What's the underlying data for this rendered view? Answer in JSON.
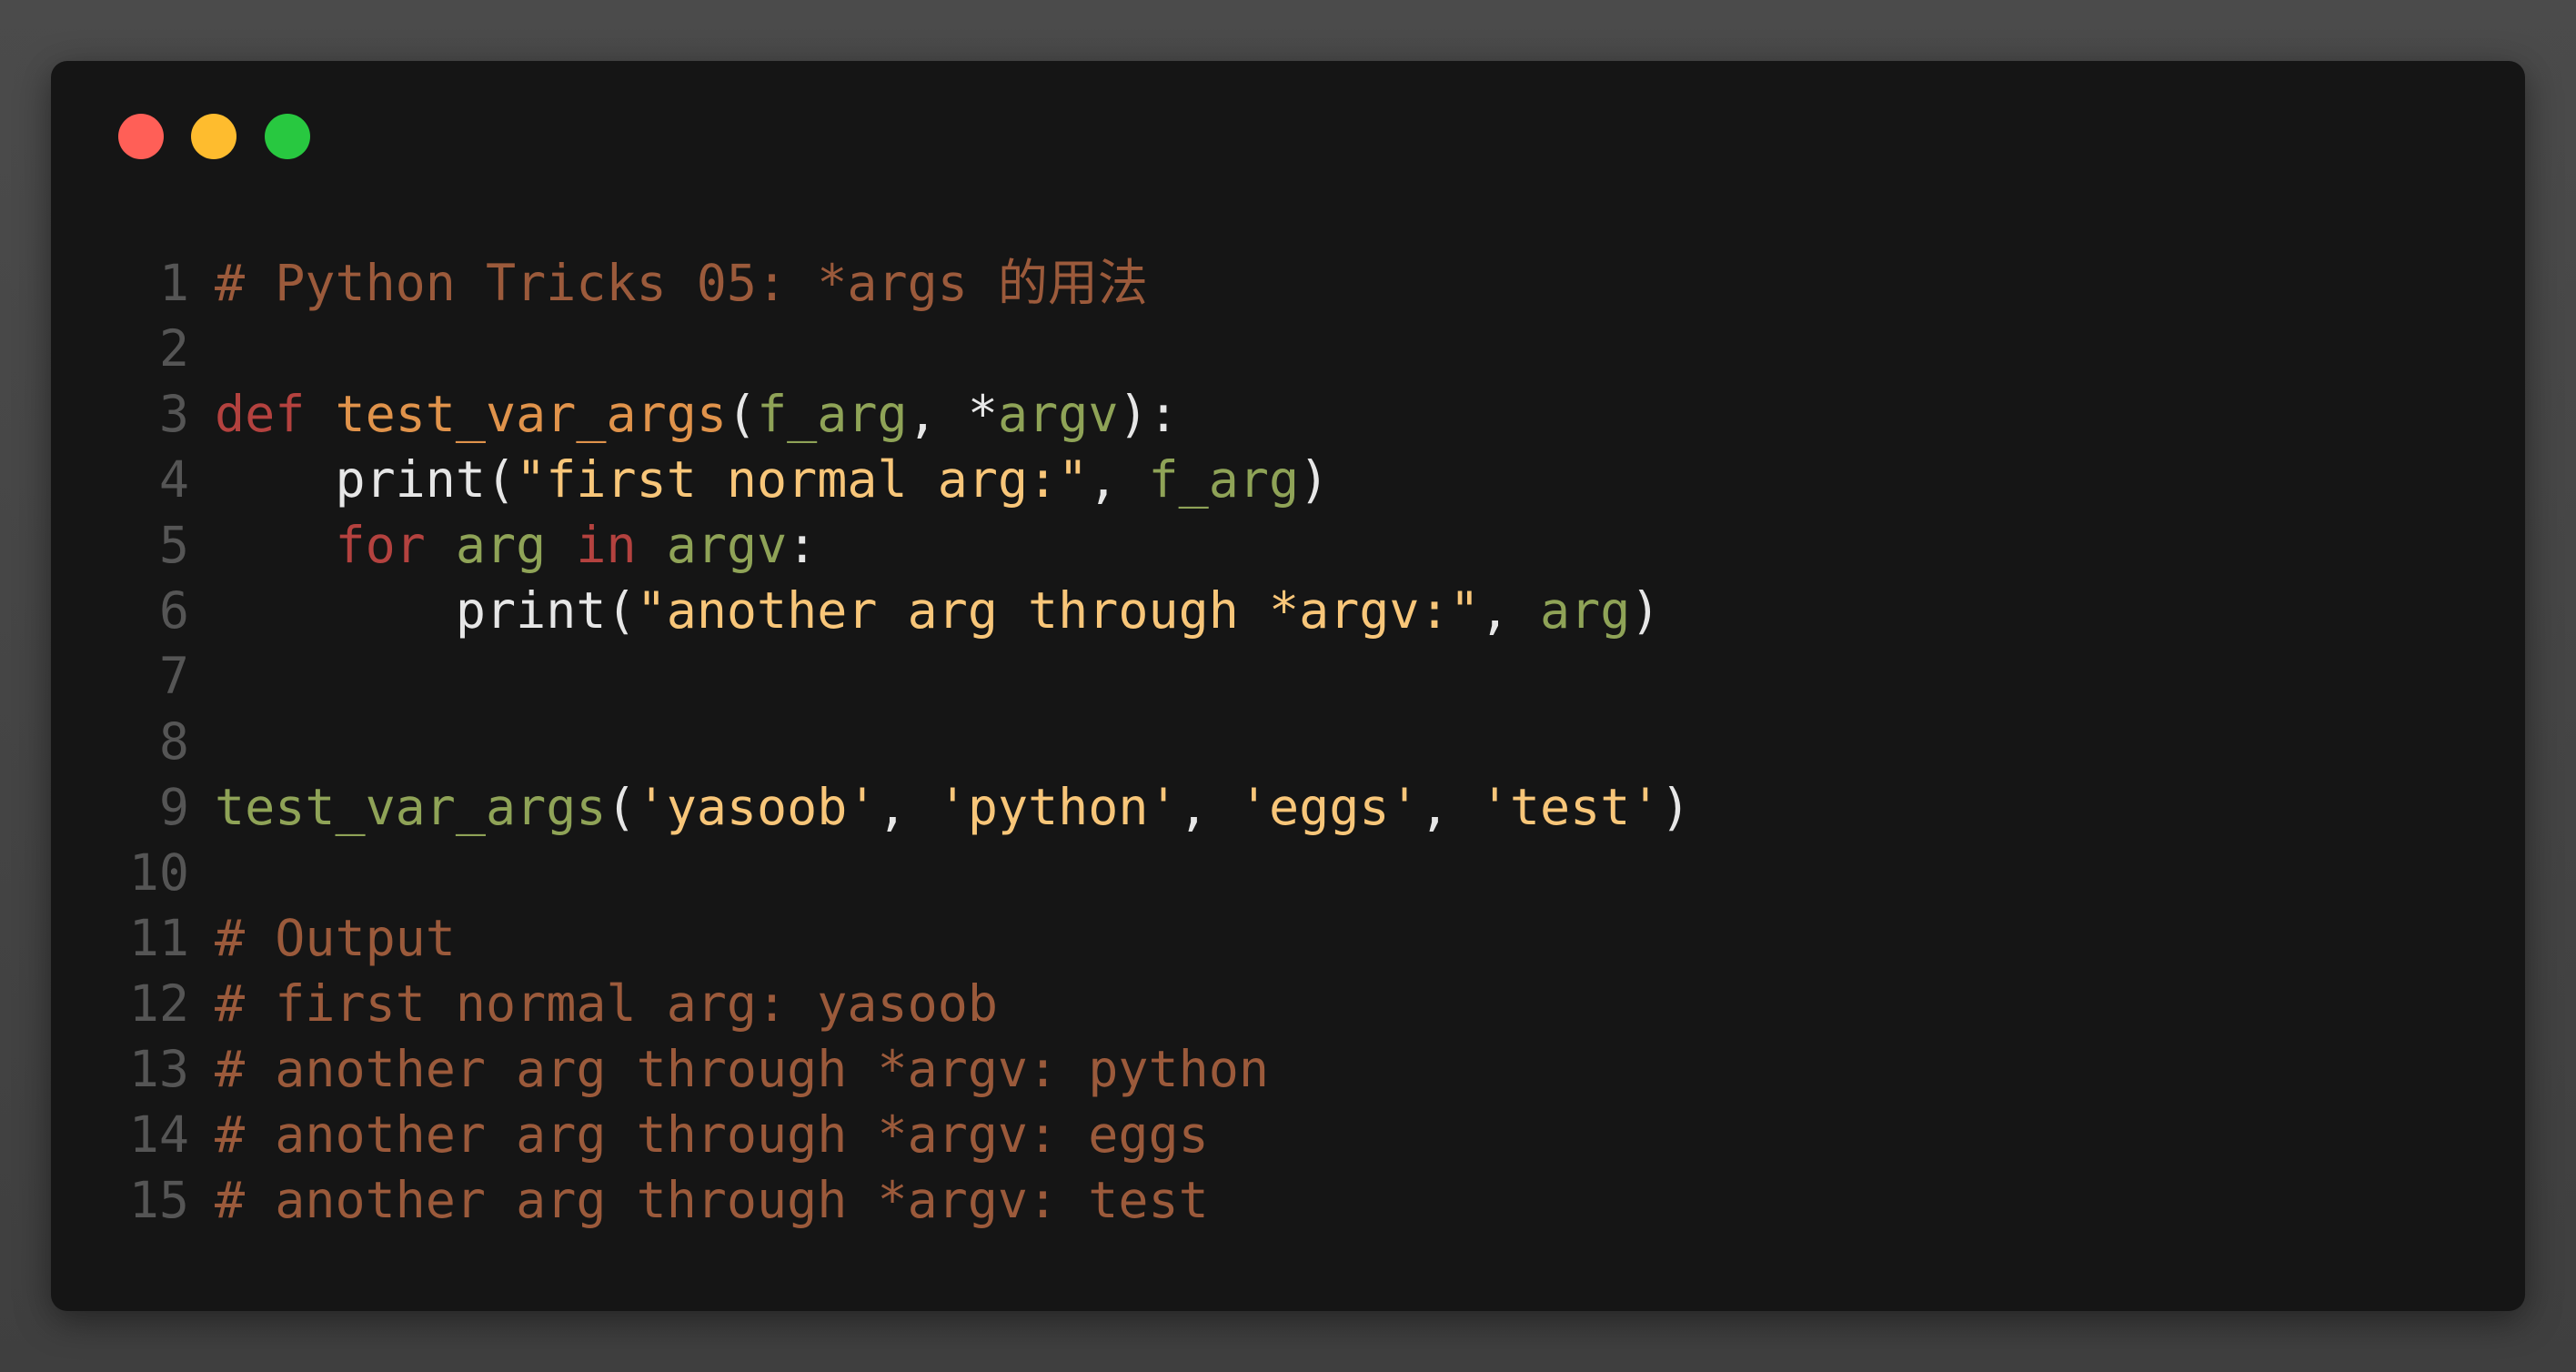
{
  "window": {
    "controls": [
      {
        "name": "close",
        "color": "#ff5f57"
      },
      {
        "name": "minimize",
        "color": "#febc2e"
      },
      {
        "name": "maximize",
        "color": "#28c840"
      }
    ]
  },
  "code": {
    "language": "python",
    "lines": [
      {
        "n": "1",
        "tokens": [
          {
            "t": "# Python Tricks 05: *args 的用法",
            "k": "comment"
          }
        ]
      },
      {
        "n": "2",
        "tokens": []
      },
      {
        "n": "3",
        "tokens": [
          {
            "t": "def",
            "k": "keyword"
          },
          {
            "t": " ",
            "k": "plain"
          },
          {
            "t": "test_var_args",
            "k": "func"
          },
          {
            "t": "(",
            "k": "plain"
          },
          {
            "t": "f_arg",
            "k": "param"
          },
          {
            "t": ", *",
            "k": "plain"
          },
          {
            "t": "argv",
            "k": "param"
          },
          {
            "t": "):",
            "k": "plain"
          }
        ]
      },
      {
        "n": "4",
        "tokens": [
          {
            "t": "    print(",
            "k": "plain"
          },
          {
            "t": "\"first normal arg:\"",
            "k": "string"
          },
          {
            "t": ", ",
            "k": "plain"
          },
          {
            "t": "f_arg",
            "k": "param"
          },
          {
            "t": ")",
            "k": "plain"
          }
        ]
      },
      {
        "n": "5",
        "tokens": [
          {
            "t": "    ",
            "k": "plain"
          },
          {
            "t": "for",
            "k": "keyword"
          },
          {
            "t": " ",
            "k": "plain"
          },
          {
            "t": "arg",
            "k": "param"
          },
          {
            "t": " ",
            "k": "plain"
          },
          {
            "t": "in",
            "k": "keyword"
          },
          {
            "t": " ",
            "k": "plain"
          },
          {
            "t": "argv",
            "k": "param"
          },
          {
            "t": ":",
            "k": "plain"
          }
        ]
      },
      {
        "n": "6",
        "tokens": [
          {
            "t": "        print(",
            "k": "plain"
          },
          {
            "t": "\"another arg through *argv:\"",
            "k": "string"
          },
          {
            "t": ", ",
            "k": "plain"
          },
          {
            "t": "arg",
            "k": "param"
          },
          {
            "t": ")",
            "k": "plain"
          }
        ]
      },
      {
        "n": "7",
        "tokens": []
      },
      {
        "n": "8",
        "tokens": []
      },
      {
        "n": "9",
        "tokens": [
          {
            "t": "test_var_args",
            "k": "call"
          },
          {
            "t": "(",
            "k": "plain"
          },
          {
            "t": "'yasoob'",
            "k": "string"
          },
          {
            "t": ", ",
            "k": "plain"
          },
          {
            "t": "'python'",
            "k": "string"
          },
          {
            "t": ", ",
            "k": "plain"
          },
          {
            "t": "'eggs'",
            "k": "string"
          },
          {
            "t": ", ",
            "k": "plain"
          },
          {
            "t": "'test'",
            "k": "string"
          },
          {
            "t": ")",
            "k": "plain"
          }
        ]
      },
      {
        "n": "10",
        "tokens": []
      },
      {
        "n": "11",
        "tokens": [
          {
            "t": "# Output",
            "k": "comment"
          }
        ]
      },
      {
        "n": "12",
        "tokens": [
          {
            "t": "# first normal arg: yasoob",
            "k": "comment"
          }
        ]
      },
      {
        "n": "13",
        "tokens": [
          {
            "t": "# another arg through *argv: python",
            "k": "comment"
          }
        ]
      },
      {
        "n": "14",
        "tokens": [
          {
            "t": "# another arg through *argv: eggs",
            "k": "comment"
          }
        ]
      },
      {
        "n": "15",
        "tokens": [
          {
            "t": "# another arg through *argv: test",
            "k": "comment"
          }
        ]
      }
    ]
  }
}
